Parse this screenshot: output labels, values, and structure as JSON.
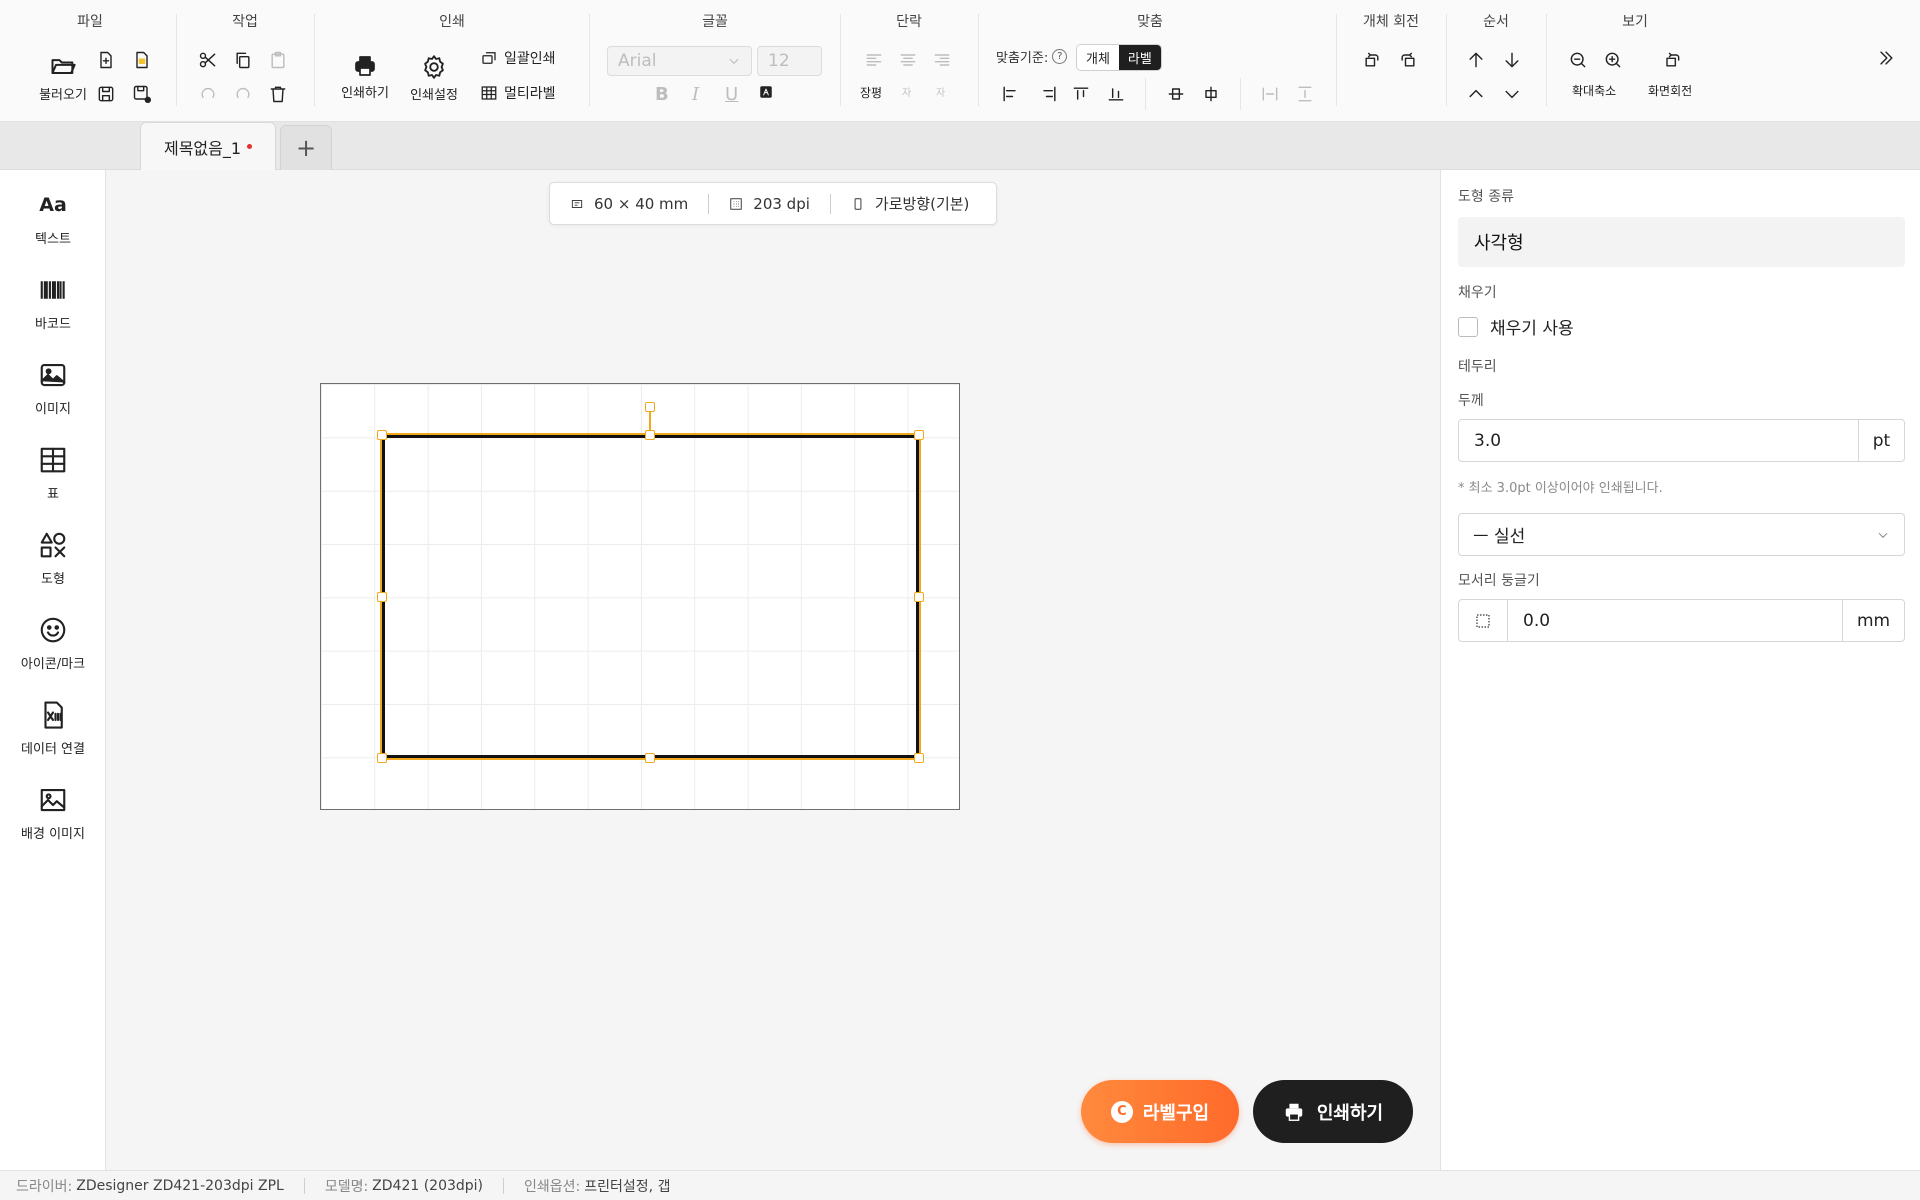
{
  "ribbon": {
    "file": {
      "title": "파일",
      "open_label": "불러오기"
    },
    "edit": {
      "title": "작업"
    },
    "print": {
      "title": "인쇄",
      "print_label": "인쇄하기",
      "settings_label": "인쇄설정",
      "batch_label": "일괄인쇄",
      "multi_label": "멀티라벨"
    },
    "font": {
      "title": "글꼴",
      "family": "Arial",
      "size": "12",
      "bold": "B",
      "italic": "I",
      "underline": "U"
    },
    "paragraph": {
      "title": "단락",
      "long_label": "장평",
      "s2": "자",
      "s3": "자"
    },
    "align": {
      "title": "맞춤",
      "ref_label": "맞춤기준:",
      "help": "?",
      "seg_object": "개체",
      "seg_label": "라벨"
    },
    "rotate": {
      "title": "개체 회전"
    },
    "order": {
      "title": "순서"
    },
    "view": {
      "title": "보기",
      "zoom_label": "확대축소",
      "rotate_label": "화면회전"
    }
  },
  "tabs": {
    "doc_name": "제목없음_1",
    "add": "+"
  },
  "sidebar": {
    "items": [
      {
        "label": "텍스트",
        "glyph": "Aa"
      },
      {
        "label": "바코드"
      },
      {
        "label": "이미지"
      },
      {
        "label": "표"
      },
      {
        "label": "도형"
      },
      {
        "label": "아이콘/마크"
      },
      {
        "label": "데이터 연결"
      },
      {
        "label": "배경 이미지"
      }
    ]
  },
  "canvas": {
    "size": "60 × 40 mm",
    "dpi": "203 dpi",
    "orientation": "가로방향(기본)"
  },
  "actions": {
    "buy_label": "라벨구입",
    "buy_icon_glyph": "C",
    "print_label": "인쇄하기"
  },
  "panel": {
    "shape_type_label": "도형 종류",
    "shape_type_value": "사각형",
    "fill_label": "채우기",
    "fill_checkbox": "채우기 사용",
    "border_label": "테두리",
    "thickness_label": "두께",
    "thickness_value": "3.0",
    "thickness_unit": "pt",
    "note": "* 최소 3.0pt 이상이어야 인쇄됩니다.",
    "line_style": "ㅡ  실선",
    "corner_label": "모서리 둥글기",
    "corner_value": "0.0",
    "corner_unit": "mm"
  },
  "status": {
    "driver_key": "드라이버:",
    "driver_val": "ZDesigner ZD421-203dpi ZPL",
    "model_key": "모델명:",
    "model_val": "ZD421 (203dpi)",
    "option_key": "인쇄옵션:",
    "option_val": "프린터설정, 갭"
  },
  "colors": {
    "accent": "#f2a81d",
    "buy": "#ff6a2a",
    "print": "#1f1f1f",
    "dirty_dot": "#e4322b"
  }
}
